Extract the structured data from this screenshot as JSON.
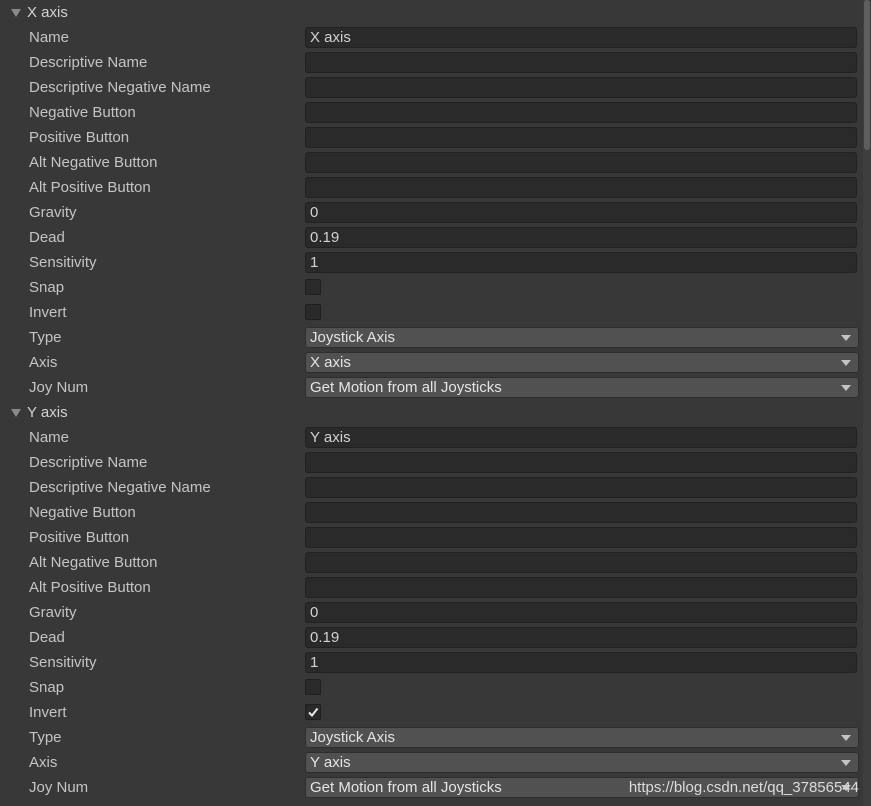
{
  "labels": {
    "name": "Name",
    "descriptive_name": "Descriptive Name",
    "descriptive_negative_name": "Descriptive Negative Name",
    "negative_button": "Negative Button",
    "positive_button": "Positive Button",
    "alt_negative_button": "Alt Negative Button",
    "alt_positive_button": "Alt Positive Button",
    "gravity": "Gravity",
    "dead": "Dead",
    "sensitivity": "Sensitivity",
    "snap": "Snap",
    "invert": "Invert",
    "type": "Type",
    "axis": "Axis",
    "joy_num": "Joy Num"
  },
  "sections": [
    {
      "title": "X axis",
      "name": "X axis",
      "descriptive_name": "",
      "descriptive_negative_name": "",
      "negative_button": "",
      "positive_button": "",
      "alt_negative_button": "",
      "alt_positive_button": "",
      "gravity": "0",
      "dead": "0.19",
      "sensitivity": "1",
      "snap": false,
      "invert": false,
      "type": "Joystick Axis",
      "axis": "X axis",
      "joy_num": "Get Motion from all Joysticks"
    },
    {
      "title": "Y axis",
      "name": "Y axis",
      "descriptive_name": "",
      "descriptive_negative_name": "",
      "negative_button": "",
      "positive_button": "",
      "alt_negative_button": "",
      "alt_positive_button": "",
      "gravity": "0",
      "dead": "0.19",
      "sensitivity": "1",
      "snap": false,
      "invert": true,
      "type": "Joystick Axis",
      "axis": "Y axis",
      "joy_num": "Get Motion from all Joysticks"
    }
  ],
  "watermark": "https://blog.csdn.net/qq_37856544",
  "colors": {
    "background": "#383838",
    "field_background": "#2a2a2a",
    "dropdown_background": "#515151",
    "label_text": "#c4c4c4"
  }
}
